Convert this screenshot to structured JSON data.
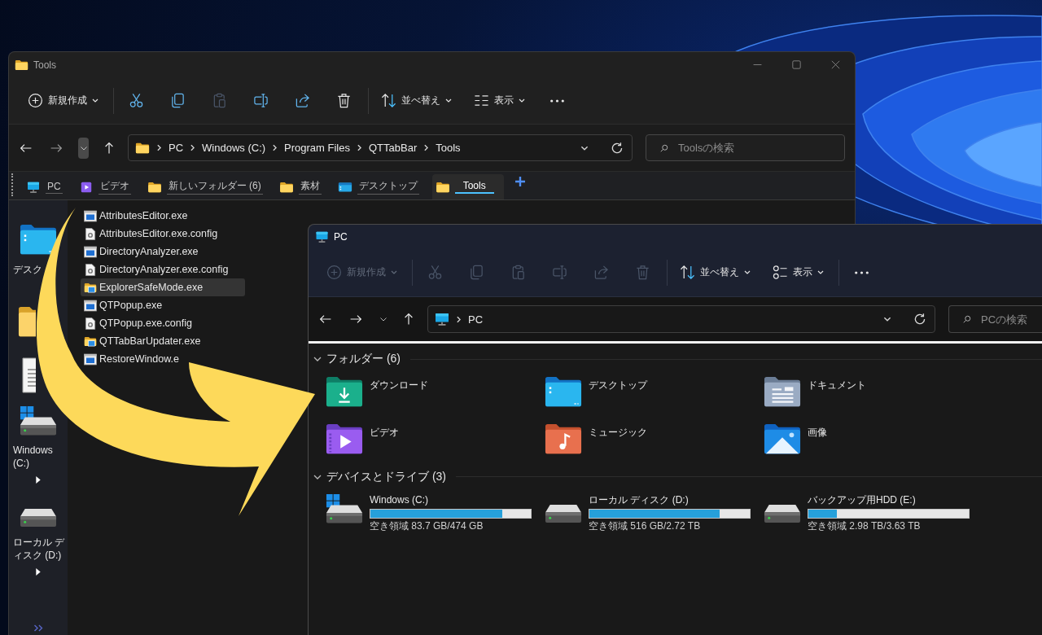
{
  "back_window": {
    "kind": "folder",
    "title": "Tools",
    "window_buttons": [
      {
        "kind": "minimize"
      },
      {
        "kind": "maximize"
      },
      {
        "kind": "close"
      }
    ],
    "toolbar_groups": [
      [
        {
          "kind": "new",
          "label": "新規作成",
          "disabled": false
        }
      ],
      [
        {
          "kind": "cut",
          "disabled": false
        },
        {
          "kind": "copy",
          "disabled": false
        },
        {
          "kind": "paste",
          "disabled": true
        },
        {
          "kind": "rename",
          "disabled": false
        },
        {
          "kind": "share",
          "disabled": false
        },
        {
          "kind": "delete",
          "disabled": false
        }
      ],
      [
        {
          "kind": "sort",
          "label": "並べ替え",
          "disabled": false
        },
        {
          "kind": "details",
          "label": "表示",
          "disabled": false
        },
        {
          "kind": "more",
          "disabled": false
        }
      ]
    ],
    "nav": [
      {
        "kind": "back",
        "disabled": false,
        "hovered": false
      },
      {
        "kind": "forward",
        "disabled": true,
        "hovered": false
      },
      {
        "kind": "recent",
        "disabled": false,
        "hovered": true
      },
      {
        "kind": "up",
        "disabled": false,
        "hovered": false
      }
    ],
    "address": {
      "kind": "folder",
      "path": [
        "PC",
        "Windows (C:)",
        "Program Files",
        "QTTabBar",
        "Tools"
      ]
    },
    "search": {
      "placeholder": "Toolsの検索"
    },
    "tabs": [
      {
        "label": "PC",
        "kind": "pc",
        "selected": false
      },
      {
        "label": "ビデオ",
        "kind": "video",
        "selected": false
      },
      {
        "label": "新しいフォルダー (6)",
        "kind": "folder",
        "selected": false
      },
      {
        "label": "素材",
        "kind": "folder",
        "selected": false
      },
      {
        "label": "デスクトップ",
        "kind": "desktop",
        "selected": false
      },
      {
        "label": "Tools",
        "kind": "folder",
        "selected": true
      }
    ],
    "sidebar": [
      {
        "kind": "desktop",
        "label": "デスク"
      },
      {
        "kind": "folder"
      },
      {
        "kind": "document"
      },
      {
        "kind": "system",
        "label": "Windows (C:)"
      },
      {
        "kind": "drive",
        "label": "ローカル ディスク (D:)"
      }
    ],
    "files": [
      {
        "name": "AttributesEditor.exe",
        "kind": "exe",
        "selected": false
      },
      {
        "name": "AttributesEditor.exe.config",
        "kind": "config",
        "selected": false
      },
      {
        "name": "DirectoryAnalyzer.exe",
        "kind": "exe",
        "selected": false
      },
      {
        "name": "DirectoryAnalyzer.exe.config",
        "kind": "config",
        "selected": false
      },
      {
        "name": "ExplorerSafeMode.exe",
        "kind": "app",
        "selected": true
      },
      {
        "name": "QTPopup.exe",
        "kind": "exe",
        "selected": false
      },
      {
        "name": "QTPopup.exe.config",
        "kind": "config",
        "selected": false
      },
      {
        "name": "QTTabBarUpdater.exe",
        "kind": "app",
        "selected": false
      },
      {
        "name": "RestoreWindow.e",
        "kind": "exe",
        "selected": false
      }
    ]
  },
  "front_window": {
    "kind": "pc",
    "title": "PC",
    "toolbar_groups": [
      [
        {
          "kind": "new",
          "label": "新規作成",
          "disabled": true
        }
      ],
      [
        {
          "kind": "cut",
          "disabled": true
        },
        {
          "kind": "copy",
          "disabled": true
        },
        {
          "kind": "paste",
          "disabled": true
        },
        {
          "kind": "rename",
          "disabled": true
        },
        {
          "kind": "share",
          "disabled": true
        },
        {
          "kind": "delete",
          "disabled": true
        }
      ],
      [
        {
          "kind": "sort",
          "label": "並べ替え",
          "disabled": false
        },
        {
          "kind": "tiles",
          "label": "表示",
          "disabled": false
        }
      ],
      [
        {
          "kind": "more",
          "disabled": false
        }
      ]
    ],
    "nav": [
      {
        "kind": "back",
        "disabled": false,
        "hovered": false
      },
      {
        "kind": "forward",
        "disabled": false,
        "hovered": false
      },
      {
        "kind": "recent",
        "disabled": false,
        "hovered": false
      },
      {
        "kind": "up",
        "disabled": false,
        "hovered": false
      }
    ],
    "address": {
      "kind": "pc",
      "path": [
        "PC"
      ]
    },
    "search": {
      "placeholder": "PCの検索"
    },
    "sections": [
      {
        "title": "フォルダー (6)",
        "kind": "folders",
        "expanded": true,
        "items": [
          {
            "name": "ダウンロード",
            "kind": "downloads"
          },
          {
            "name": "デスクトップ",
            "kind": "desktop"
          },
          {
            "name": "ドキュメント",
            "kind": "documents"
          },
          {
            "name": "ビデオ",
            "kind": "videos"
          },
          {
            "name": "ミュージック",
            "kind": "music"
          },
          {
            "name": "画像",
            "kind": "pictures"
          }
        ]
      },
      {
        "title": "デバイスとドライブ (3)",
        "kind": "drives",
        "expanded": true,
        "items": [
          {
            "name": "Windows (C:)",
            "kind": "system",
            "level": 0.82,
            "space": "空き領域 83.7 GB/474 GB"
          },
          {
            "name": "ローカル ディスク (D:)",
            "kind": "drive",
            "level": 0.81,
            "space": "空き領域 516 GB/2.72 TB"
          },
          {
            "name": "バックアップ用HDD (E:)",
            "kind": "drive",
            "level": 0.18,
            "space": "空き領域 2.98 TB/3.63 TB"
          }
        ]
      }
    ]
  }
}
